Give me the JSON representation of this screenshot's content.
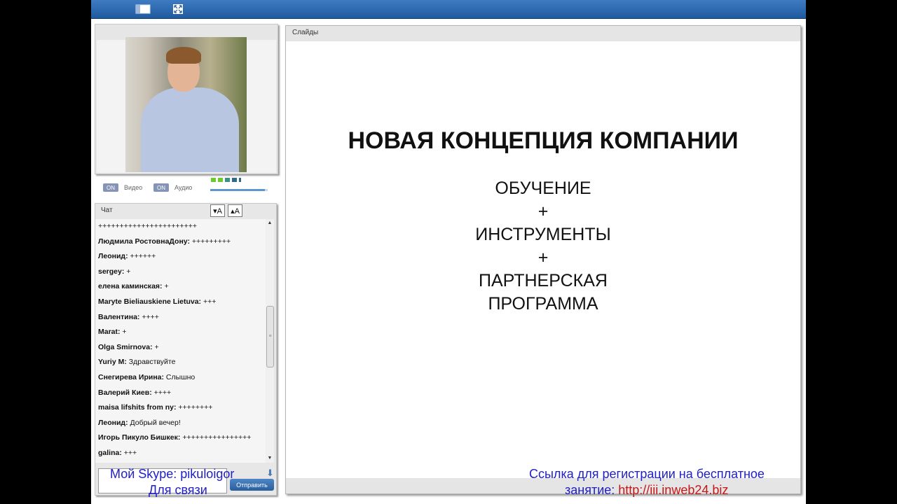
{
  "toolbar": {
    "icons": [
      "panel-toggle-icon",
      "fullscreen-icon"
    ]
  },
  "video": {
    "video_toggle": "ON",
    "video_label": "Видео",
    "audio_toggle": "ON",
    "audio_label": "Аудио",
    "volume_fraction": 0.95
  },
  "chat": {
    "title": "Чат",
    "font_decrease": "▾A",
    "font_increase": "▴A",
    "send_label": "Отправить",
    "messages": [
      {
        "author": "",
        "text": "+++++++++++++++++++++++"
      },
      {
        "author": "Людмила РостовнаДону:",
        "text": " +++++++++"
      },
      {
        "author": "Леонид:",
        "text": " ++++++"
      },
      {
        "author": "sergey:",
        "text": " +"
      },
      {
        "author": "елена каминская:",
        "text": " +"
      },
      {
        "author": "Maryte Bieliauskiene Lietuva:",
        "text": " +++"
      },
      {
        "author": "Валентина:",
        "text": " ++++"
      },
      {
        "author": "Marat:",
        "text": " +"
      },
      {
        "author": "Olga Smirnova:",
        "text": " +"
      },
      {
        "author": "Yuriy M:",
        "text": " Здравствуйте"
      },
      {
        "author": "Снегирева Ирина:",
        "text": " Слышно"
      },
      {
        "author": "Валерий Киев:",
        "text": " ++++"
      },
      {
        "author": "maisa lifshits from ny:",
        "text": " ++++++++"
      },
      {
        "author": "Леонид:",
        "text": " Добрый вечер!"
      },
      {
        "author": "Игорь Пикуло Бишкек:",
        "text": " ++++++++++++++++"
      },
      {
        "author": "galina:",
        "text": " +++"
      }
    ]
  },
  "slides": {
    "title": "Слайды",
    "heading": "НОВАЯ КОНЦЕПЦИЯ КОМПАНИИ",
    "line1": "ОБУЧЕНИЕ",
    "plus1": "+",
    "line2": "ИНСТРУМЕНТЫ",
    "plus2": "+",
    "line3": "ПАРТНЕРСКАЯ",
    "line4": "ПРОГРАММА"
  },
  "overlay": {
    "skype": "Мой Skype: pikulоigor",
    "contact": "Для связи",
    "register_line1": "Ссылка для регистрации на бесплатное",
    "register_line2": "занятие:",
    "register_url": "http://iii.inweb24.biz"
  }
}
